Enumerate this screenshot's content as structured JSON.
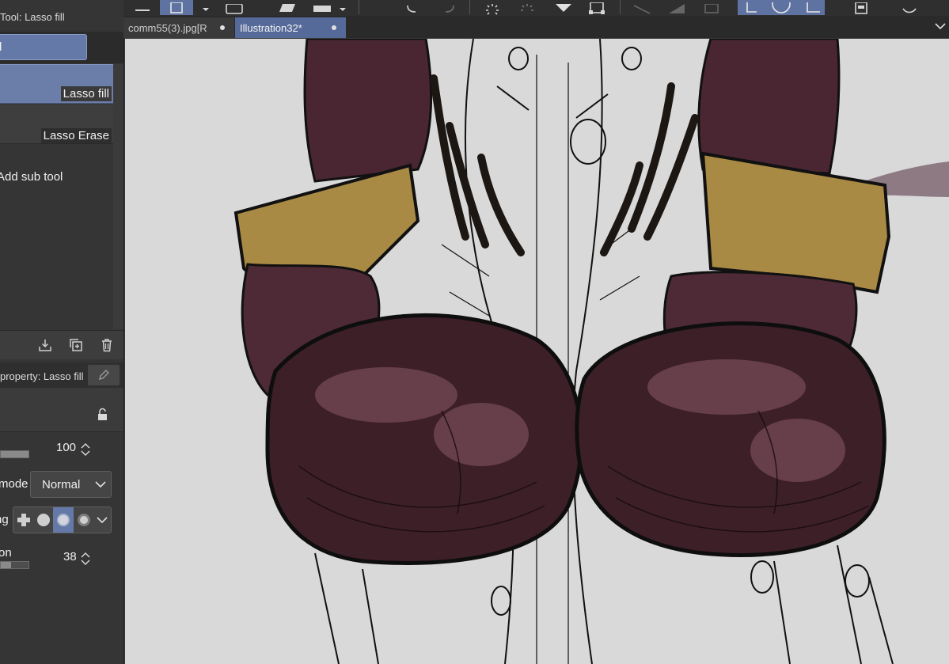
{
  "left_panel": {
    "sub_tool_panel_title": "Tool: Lasso fill",
    "tool_group_label": "l",
    "sub_tools": [
      {
        "label": "Lasso fill",
        "selected": true
      },
      {
        "label": "Lasso Erase",
        "selected": false
      }
    ],
    "add_sub_tool_label": "Add sub tool",
    "footer_icons": [
      "download-icon",
      "duplicate-icon",
      "trash-icon"
    ],
    "tool_property_title": "property: Lasso fill",
    "properties": {
      "opacity_value": "100",
      "opacity_fraction": 1.0,
      "blending_mode_label": "mode",
      "blending_mode_value": "Normal",
      "anti_aliasing_label": "ng",
      "anti_aliasing_options": [
        "none",
        "weak",
        "medium",
        "strong"
      ],
      "anti_aliasing_selected": "medium",
      "expansion_label": "on",
      "expansion_value": "38",
      "expansion_fraction": 0.38
    }
  },
  "tabs": [
    {
      "label": "comm55(3).jpg[R",
      "active": false,
      "modified": true
    },
    {
      "label": "Illustration32*",
      "active": true,
      "modified": true
    }
  ],
  "colors": {
    "accent": "#6579a8",
    "panel_bg": "#353535",
    "canvas_bg": "#d9d9da",
    "glove_dark": "#3d1f28",
    "glove_mid": "#5a3542",
    "cuff_gold": "#a98a45"
  }
}
